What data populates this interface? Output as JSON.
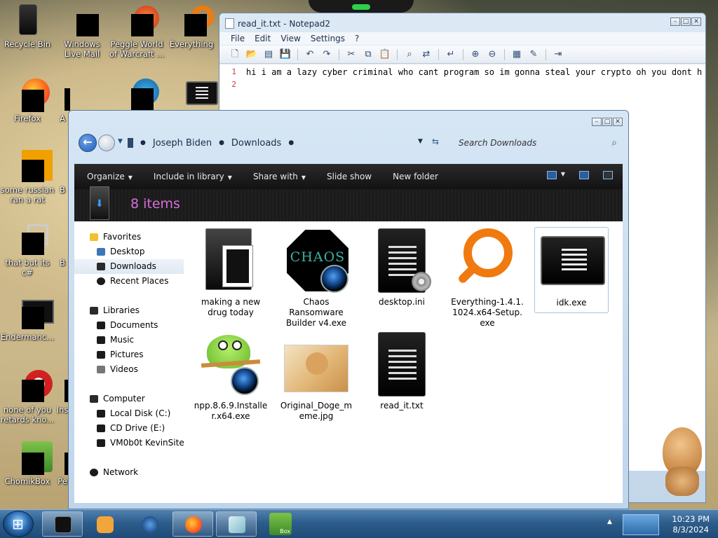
{
  "desktop": {
    "icons": [
      {
        "label": "Recycle Bin"
      },
      {
        "label": "Windows Live Mail"
      },
      {
        "label": "Peggle World of Warcraft ..."
      },
      {
        "label": "Everything"
      },
      {
        "label": "Firefox"
      },
      {
        "label": "A"
      },
      {
        "label": "some russian ran a rat"
      },
      {
        "label": "B"
      },
      {
        "label": "that but its c#"
      },
      {
        "label": "B"
      },
      {
        "label": "Endermanc..."
      },
      {
        "label": "none of you retards kno..."
      },
      {
        "label": "Ins"
      },
      {
        "label": "ChomikBox"
      },
      {
        "label": "Pe"
      }
    ]
  },
  "notepad": {
    "title": "read_it.txt - Notepad2",
    "menu": [
      "File",
      "Edit",
      "View",
      "Settings",
      "?"
    ],
    "lines": [
      {
        "num": "1",
        "text": "hi i am a lazy cyber criminal who cant program so im gonna steal your crypto oh you dont have"
      },
      {
        "num": "2",
        "text": ""
      }
    ]
  },
  "explorer": {
    "path": [
      "Joseph Biden",
      "Downloads"
    ],
    "search_placeholder": "Search Downloads",
    "commands": [
      "Organize",
      "Include in library",
      "Share with",
      "Slide show",
      "New folder"
    ],
    "item_count": "8 items",
    "nav": {
      "favorites": "Favorites",
      "desktop": "Desktop",
      "downloads": "Downloads",
      "recent": "Recent Places",
      "libraries": "Libraries",
      "documents": "Documents",
      "music": "Music",
      "pictures": "Pictures",
      "videos": "Videos",
      "computer": "Computer",
      "local_disk": "Local Disk (C:)",
      "cd_drive": "CD Drive (E:)",
      "vm_share": "VM0b0t KevinSite",
      "network": "Network"
    },
    "files": [
      {
        "name": "making a new drug today"
      },
      {
        "name": "Chaos Ransomware Builder v4.exe",
        "art_text": "CHAOS"
      },
      {
        "name": "desktop.ini"
      },
      {
        "name": "Everything-1.4.1.1024.x64-Setup.exe"
      },
      {
        "name": "idk.exe"
      },
      {
        "name": "npp.8.6.9.Installer.x64.exe"
      },
      {
        "name": "Original_Doge_meme.jpg"
      },
      {
        "name": "read_it.txt"
      }
    ]
  },
  "taskbar": {
    "time": "10:23 PM",
    "date": "8/3/2024",
    "chomik_label": "Box"
  }
}
